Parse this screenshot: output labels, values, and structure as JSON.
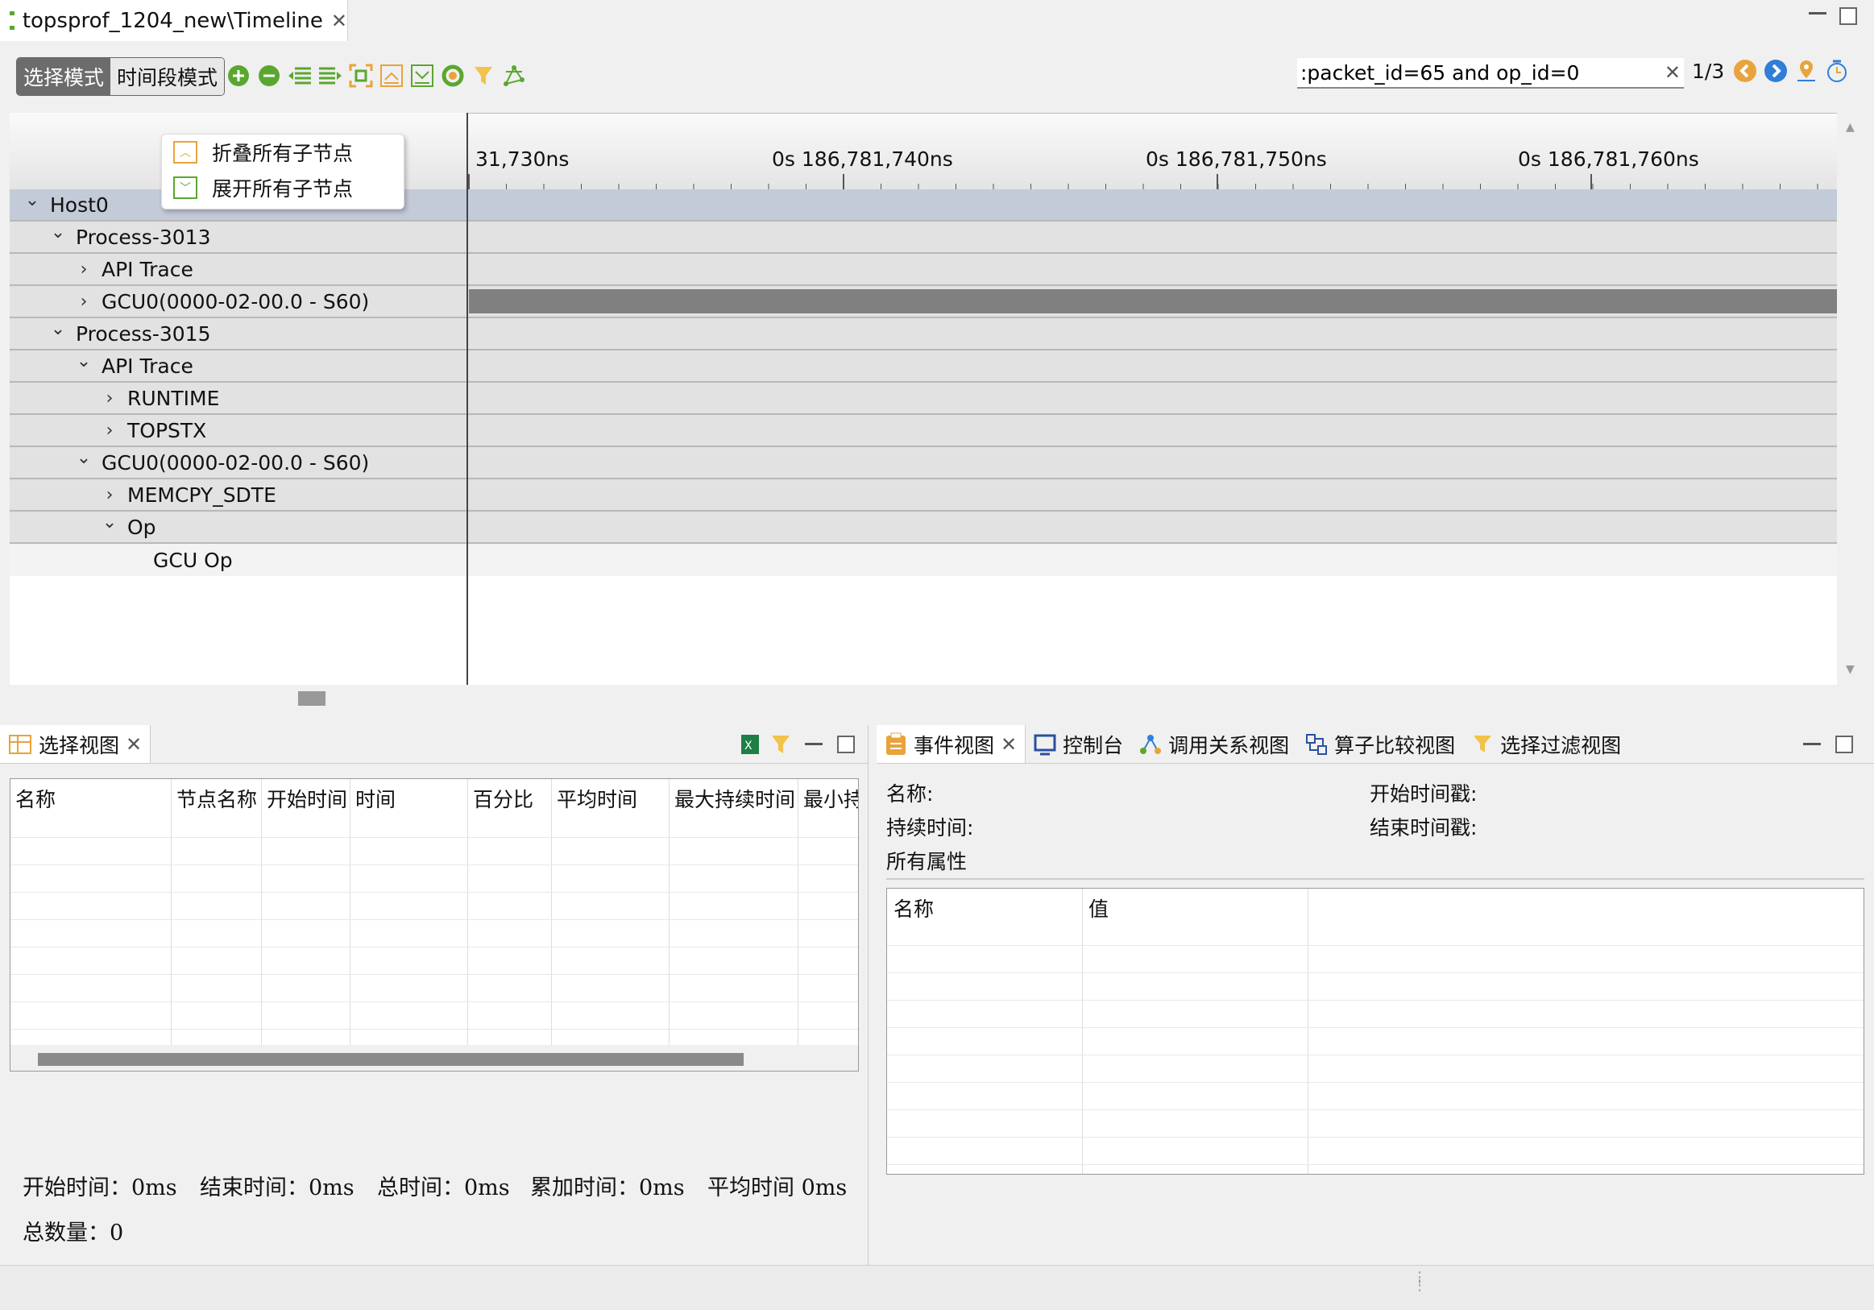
{
  "window": {
    "tab_title": "topsprof_1204_new\\Timeline"
  },
  "toolbar": {
    "mode_select": "选择模式",
    "mode_range": "时间段模式",
    "icons": [
      "zoom-in-icon",
      "zoom-out-icon",
      "collapse-list-icon",
      "expand-list-icon",
      "fit-icon",
      "collapse-all-icon",
      "expand-all-icon",
      "refresh-icon",
      "filter-icon",
      "graph-icon"
    ],
    "search_value": ":packet_id=65 and op_id=0",
    "match_count": "1/3"
  },
  "timeline": {
    "ticks": [
      "31,730ns",
      "0s 186,781,740ns",
      "0s 186,781,750ns",
      "0s 186,781,760ns"
    ],
    "rows": [
      {
        "label": "Host0",
        "indent": 0,
        "chevron": "down",
        "highlight": true
      },
      {
        "label": "Process-3013",
        "indent": 1,
        "chevron": "down"
      },
      {
        "label": "API Trace",
        "indent": 2,
        "chevron": "right"
      },
      {
        "label": "GCU0(0000-02-00.0 - S60)",
        "indent": 2,
        "chevron": "right",
        "bar": true
      },
      {
        "label": "Process-3015",
        "indent": 1,
        "chevron": "down"
      },
      {
        "label": "API Trace",
        "indent": 2,
        "chevron": "down"
      },
      {
        "label": "RUNTIME",
        "indent": 3,
        "chevron": "right"
      },
      {
        "label": "TOPSTX",
        "indent": 3,
        "chevron": "right"
      },
      {
        "label": "GCU0(0000-02-00.0 - S60)",
        "indent": 2,
        "chevron": "down"
      },
      {
        "label": "MEMCPY_SDTE",
        "indent": 3,
        "chevron": "right"
      },
      {
        "label": "Op",
        "indent": 3,
        "chevron": "down"
      },
      {
        "label": "GCU Op",
        "indent": 4,
        "chevron": "none",
        "light": true
      }
    ],
    "popup": {
      "collapse_all": "折叠所有子节点",
      "expand_all": "展开所有子节点"
    }
  },
  "selection_view": {
    "tab": "选择视图",
    "columns": [
      "名称",
      "节点名称",
      "开始时间",
      "时间",
      "百分比",
      "平均时间",
      "最大持续时间",
      "最小持"
    ],
    "summary": {
      "start": "开始时间：0ms",
      "end": "结束时间：0ms",
      "total": "总时间：0ms",
      "accum": "累加时间：0ms",
      "avg": "平均时间 0ms",
      "count": "总数量：0"
    }
  },
  "event_view": {
    "tabs": [
      "事件视图",
      "控制台",
      "调用关系视图",
      "算子比较视图",
      "选择过滤视图"
    ],
    "fields": {
      "name": "名称:",
      "start_ts": "开始时间戳:",
      "duration": "持续时间:",
      "end_ts": "结束时间戳:",
      "all_props": "所有属性"
    },
    "columns": [
      "名称",
      "值"
    ]
  },
  "colors": {
    "accent_green": "#5aa72f",
    "accent_orange": "#e8a33c",
    "accent_blue": "#2f7ed8",
    "row_bg": "#e2e2e2",
    "row_highlight": "#c3cad8",
    "bar": "#808080"
  }
}
